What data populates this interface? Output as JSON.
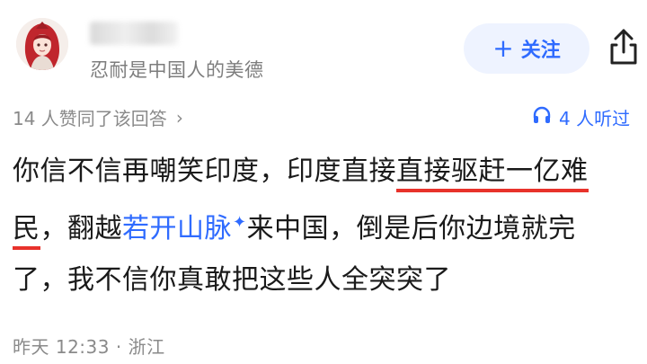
{
  "user": {
    "signature": "忍耐是中国人的美德"
  },
  "actions": {
    "follow_plus": "+",
    "follow_label": "关注",
    "share_icon": "share-icon"
  },
  "stats": {
    "likes_text": "14 人赞同了该回答",
    "likes_chevron": "›",
    "listen_text": "4 人听过",
    "listen_icon": "headphones-icon"
  },
  "answer": {
    "seg1": "你信不信再嘲笑印度，印度直接",
    "seg2_underlined": "直接驱赶一亿难",
    "seg3_underlined": "民",
    "seg4": "，翻越",
    "link_text": "若开山脉",
    "link_star": "✦",
    "seg5": "来中国，倒是后你边境就完",
    "seg6": "了，我不信你真敢把这些人全突突了"
  },
  "footer": {
    "meta": "昨天 12:33 · 浙江"
  },
  "colors": {
    "accent": "#2f6bff",
    "underline": "#e8322b",
    "muted": "#8a8a8a"
  }
}
